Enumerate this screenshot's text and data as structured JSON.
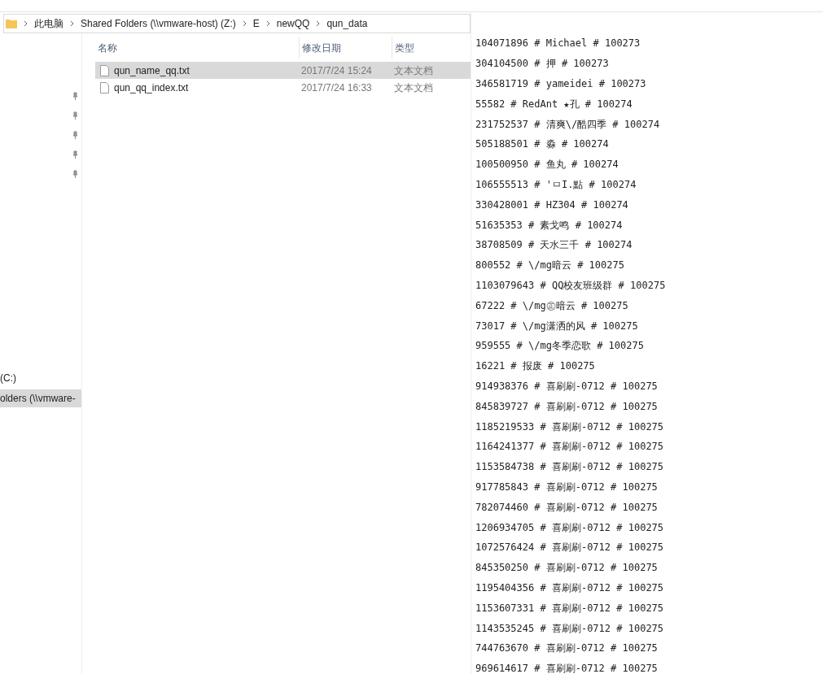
{
  "address_bar": {
    "segments": [
      "此电脑",
      "Shared Folders (\\\\vmware-host) (Z:)",
      "E",
      "newQQ",
      "qun_data"
    ]
  },
  "nav_pane": {
    "pinned_count_items": [
      {
        "pinned": true
      },
      {
        "pinned": true
      },
      {
        "pinned": true
      },
      {
        "pinned": true
      },
      {
        "pinned": true
      }
    ],
    "items": [
      {
        "label": "(C:)",
        "selected": false
      },
      {
        "label": "olders (\\\\vmware-",
        "selected": true
      }
    ]
  },
  "file_list": {
    "columns": [
      "名称",
      "修改日期",
      "类型"
    ],
    "rows": [
      {
        "name": "qun_name_qq.txt",
        "modified": "2017/7/24 15:24",
        "type": "文本文档",
        "selected": true
      },
      {
        "name": "qun_qq_index.txt",
        "modified": "2017/7/24 16:33",
        "type": "文本文档",
        "selected": false
      }
    ]
  },
  "text_view": {
    "lines": [
      "104071896 # Michael # 100273",
      "304104500 # 押 # 100273",
      "346581719 # yameidei # 100273",
      "55582 # RedAnt ★孔 # 100274",
      "231752537 # 清爽\\/酷四季 # 100274",
      "505188501 # 淼 # 100274",
      "100500950 # 鱼丸 # 100274",
      "106555513 # 'ㅁI.點 # 100274",
      "330428001 # HZ304 # 100274",
      "51635353 # 素戈鸣 # 100274",
      "38708509 # 天水三千 # 100274",
      "800552 # \\/mg暗云 # 100275",
      "1103079643 # QQ校友班级群 # 100275",
      "67222 # \\/mg㊣暗云 # 100275",
      "73017 # \\/mg潇洒的风 # 100275",
      "959555 # \\/mg冬季恋歌 # 100275",
      "16221 # 报废 # 100275",
      "914938376 # 喜刷刷-0712 # 100275",
      "845839727 # 喜刷刷-0712 # 100275",
      "1185219533 # 喜刷刷-0712 # 100275",
      "1164241377 # 喜刷刷-0712 # 100275",
      "1153584738 # 喜刷刷-0712 # 100275",
      "917785843 # 喜刷刷-0712 # 100275",
      "782074460 # 喜刷刷-0712 # 100275",
      "1206934705 # 喜刷刷-0712 # 100275",
      "1072576424 # 喜刷刷-0712 # 100275",
      "845350250 # 喜刷刷-0712 # 100275",
      "1195404356 # 喜刷刷-0712 # 100275",
      "1153607331 # 喜刷刷-0712 # 100275",
      "1143535245 # 喜刷刷-0712 # 100275",
      "744763670 # 喜刷刷-0712 # 100275",
      "969614617 # 喜刷刷-0712 # 100275"
    ]
  }
}
